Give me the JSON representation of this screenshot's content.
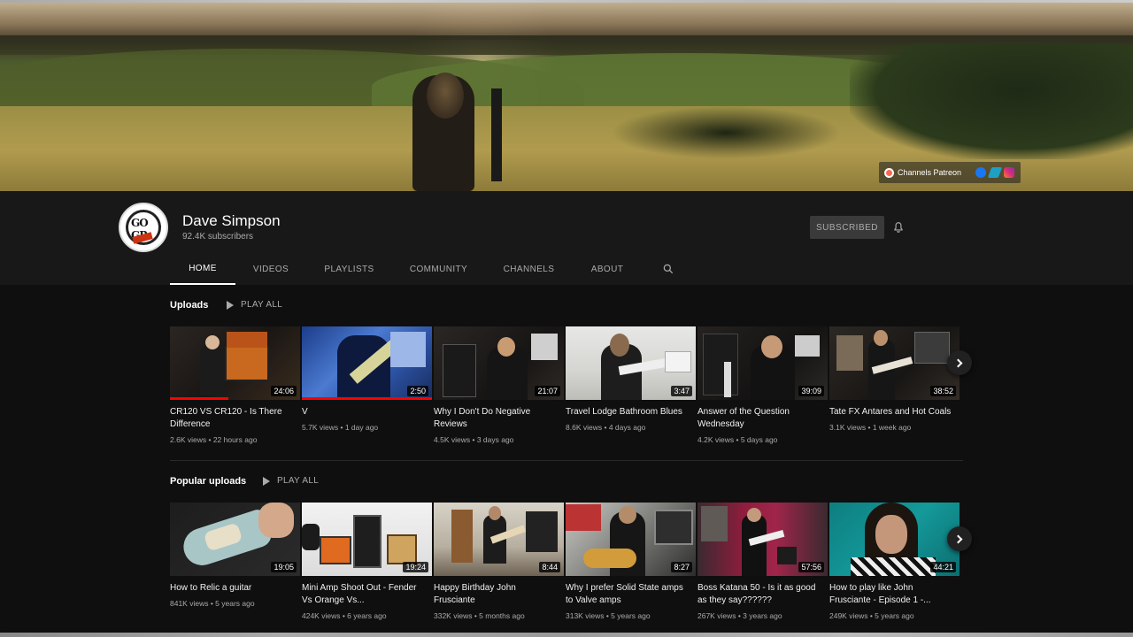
{
  "banner": {
    "links": {
      "patreon_label": "Channels Patreon",
      "icons": [
        "patreon-icon",
        "facebook-icon",
        "bandcamp-icon",
        "instagram-icon"
      ]
    }
  },
  "channel": {
    "name": "Dave Simpson",
    "subscribers": "92.4K subscribers",
    "subscribed_label": "SUBSCRIBED"
  },
  "tabs": [
    {
      "label": "HOME",
      "active": true
    },
    {
      "label": "VIDEOS"
    },
    {
      "label": "PLAYLISTS"
    },
    {
      "label": "COMMUNITY"
    },
    {
      "label": "CHANNELS"
    },
    {
      "label": "ABOUT"
    }
  ],
  "uploads": {
    "title": "Uploads",
    "play_all": "PLAY ALL",
    "videos": [
      {
        "title": "CR120 VS CR120 - Is There Difference",
        "duration": "24:06",
        "views": "2.6K views",
        "age": "22 hours ago",
        "progress": 0.45
      },
      {
        "title": "V",
        "duration": "2:50",
        "views": "5.7K views",
        "age": "1 day ago",
        "progress": 1.0
      },
      {
        "title": "Why I Don't Do Negative Reviews",
        "duration": "21:07",
        "views": "4.5K views",
        "age": "3 days ago",
        "progress": 0
      },
      {
        "title": "Travel Lodge Bathroom Blues",
        "duration": "3:47",
        "views": "8.6K views",
        "age": "4 days ago",
        "progress": 0
      },
      {
        "title": "Answer of the Question Wednesday",
        "duration": "39:09",
        "views": "4.2K views",
        "age": "5 days ago",
        "progress": 0
      },
      {
        "title": "Tate FX Antares and Hot Coals",
        "duration": "38:52",
        "views": "3.1K views",
        "age": "1 week ago",
        "progress": 0
      }
    ]
  },
  "popular": {
    "title": "Popular uploads",
    "play_all": "PLAY ALL",
    "videos": [
      {
        "title": "How to Relic a guitar",
        "duration": "19:05",
        "views": "841K views",
        "age": "5 years ago"
      },
      {
        "title": "Mini Amp Shoot Out - Fender Vs Orange Vs...",
        "duration": "19:24",
        "views": "424K views",
        "age": "6 years ago"
      },
      {
        "title": "Happy Birthday John Frusciante",
        "duration": "8:44",
        "views": "332K views",
        "age": "5 months ago"
      },
      {
        "title": "Why I prefer Solid State amps to Valve amps",
        "duration": "8:27",
        "views": "313K views",
        "age": "5 years ago"
      },
      {
        "title": "Boss Katana 50 - Is it as good as they say??????",
        "duration": "57:56",
        "views": "267K views",
        "age": "3 years ago"
      },
      {
        "title": "How to play like John Frusciante - Episode 1 -...",
        "duration": "44:21",
        "views": "249K views",
        "age": "5 years ago"
      }
    ]
  },
  "colors": {
    "accent": "#ff0000",
    "background": "#0f0f0f",
    "header": "#181818"
  }
}
